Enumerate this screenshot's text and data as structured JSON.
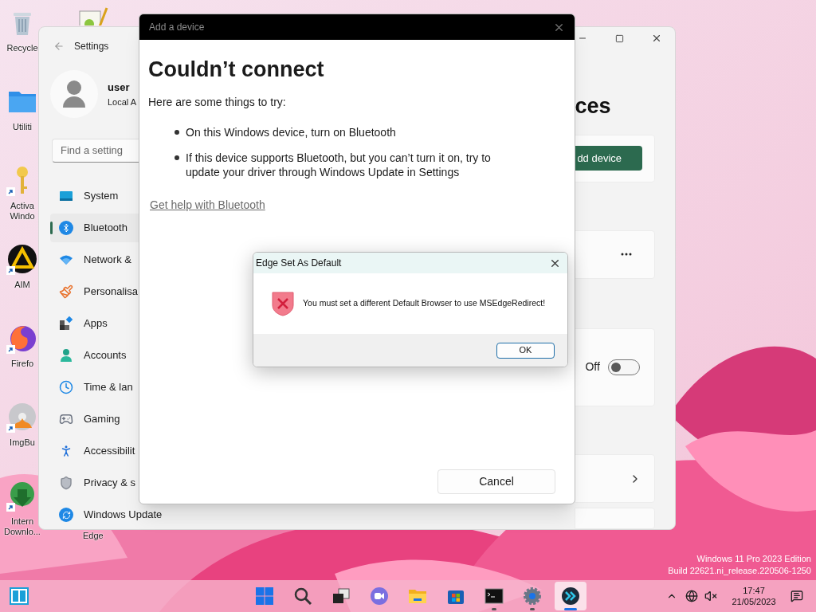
{
  "desktop": {
    "icons": [
      {
        "kind": "recycle-bin",
        "label": [
          "Recycle"
        ],
        "shortcut": false
      },
      {
        "kind": "folder",
        "label": [
          "Utiliti"
        ],
        "shortcut": false
      },
      {
        "kind": "key",
        "label": [
          "Activa",
          "Windo"
        ],
        "shortcut": true
      },
      {
        "kind": "triangle",
        "label": [
          "AIM"
        ],
        "shortcut": true
      },
      {
        "kind": "flame-globe",
        "label": [
          "Firefo"
        ],
        "shortcut": true
      },
      {
        "kind": "disc",
        "label": [
          "ImgBu"
        ],
        "shortcut": true
      },
      {
        "kind": "globe-arrow",
        "label": [
          "Intern",
          "Downlo..."
        ],
        "shortcut": true
      }
    ],
    "top_icon": {
      "kind": "notepad"
    },
    "bottom_label": "Edge",
    "edition": [
      "Windows 11 Pro 2023 Edition",
      "Build 22621.ni_release.220506-1250"
    ]
  },
  "settings": {
    "title": "Settings",
    "user": {
      "name": "user",
      "account": "Local A"
    },
    "search": {
      "placeholder": "Find a setting"
    },
    "nav": [
      {
        "kind": "system",
        "label": "System",
        "selected": false
      },
      {
        "kind": "bluetooth",
        "label": "Bluetooth",
        "selected": true
      },
      {
        "kind": "network",
        "label": "Network &",
        "selected": false
      },
      {
        "kind": "personalisation",
        "label": "Personalisa",
        "selected": false
      },
      {
        "kind": "apps",
        "label": "Apps",
        "selected": false
      },
      {
        "kind": "accounts",
        "label": "Accounts",
        "selected": false
      },
      {
        "kind": "time",
        "label": "Time & lan",
        "selected": false
      },
      {
        "kind": "gaming",
        "label": "Gaming",
        "selected": false
      },
      {
        "kind": "accessibility",
        "label": "Accessibilit",
        "selected": false
      },
      {
        "kind": "privacy",
        "label": "Privacy & s",
        "selected": false
      },
      {
        "kind": "update",
        "label": "Windows Update",
        "selected": false
      }
    ],
    "heading": "ces",
    "add_button": "dd device",
    "toggle": {
      "label": "Off",
      "on": false
    }
  },
  "add_device": {
    "title": "Add a device",
    "heading": "Couldn’t connect",
    "intro": "Here are some things to try:",
    "tips": [
      "On this Windows device, turn on Bluetooth",
      "If this device supports Bluetooth, but you can’t turn it on, try to update your driver through Windows Update in Settings"
    ],
    "link": "Get help with Bluetooth",
    "cancel": "Cancel"
  },
  "message_box": {
    "title": "Edge Set As Default",
    "message": "You must set a different Default Browser to use MSEdgeRedirect!",
    "ok": "OK"
  },
  "taskbar": {
    "apps": [
      {
        "kind": "start",
        "running": false,
        "selected": false
      },
      {
        "kind": "search",
        "running": false,
        "selected": false
      },
      {
        "kind": "task-view",
        "running": false,
        "selected": false
      },
      {
        "kind": "chat",
        "running": false,
        "selected": false
      },
      {
        "kind": "explorer",
        "running": false,
        "selected": false
      },
      {
        "kind": "store",
        "running": false,
        "selected": false
      },
      {
        "kind": "terminal",
        "running": true,
        "selected": false
      },
      {
        "kind": "settings",
        "running": true,
        "selected": false
      },
      {
        "kind": "redirect",
        "running": true,
        "selected": true
      }
    ],
    "time": "17:47",
    "date": "21/05/2023"
  }
}
